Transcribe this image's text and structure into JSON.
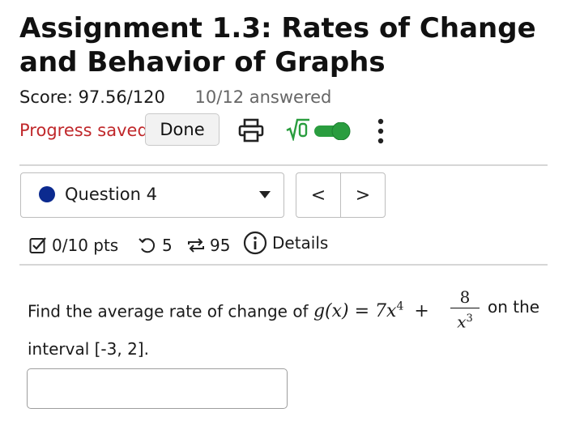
{
  "assignment": {
    "title": "Assignment 1.3: Rates of Change and Behavior of Graphs",
    "score": "Score: 97.56/120",
    "answered": "10/12 answered"
  },
  "status": {
    "progress_text": "Progress saved",
    "done_label": "Done",
    "sqrt_label": "√0",
    "accent_green": "#2a9d3f",
    "progress_red": "#c0282b"
  },
  "question_nav": {
    "selected": "Question 4",
    "prev_label": "<",
    "next_label": ">"
  },
  "question_meta": {
    "points": "0/10 pts",
    "retries": "5",
    "attempts": "95",
    "details_label": "Details"
  },
  "question": {
    "text_before": "Find the average rate of change of",
    "func_lhs": "g(x) = 7x",
    "exponent": "4",
    "plus": "+",
    "frac_num": "8",
    "frac_den": "x",
    "frac_den_exp": "3",
    "text_after": "on the",
    "line2": "interval [-3, 2]."
  },
  "answer": {
    "value": ""
  }
}
